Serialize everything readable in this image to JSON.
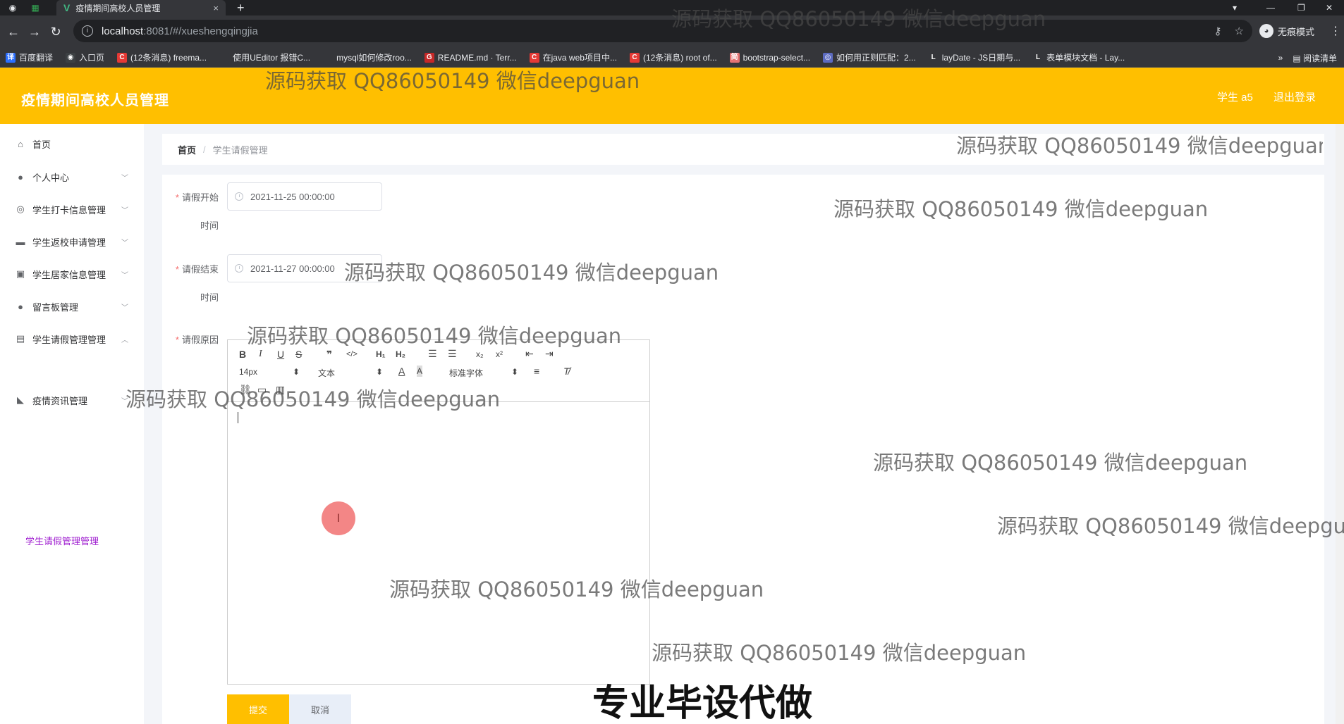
{
  "browser": {
    "tab_title": "疫情期间高校人员管理",
    "tab_close": "×",
    "new_tab": "+",
    "url_host": "localhost",
    "url_path": ":8081/#/xueshengqingjia",
    "incognito_label": "无痕模式",
    "bookmarks": [
      {
        "label": "百度翻译",
        "color": "#2b6fff",
        "glyph": "译"
      },
      {
        "label": "入口页",
        "color": "#3c4043",
        "glyph": "◉"
      },
      {
        "label": "(12条消息) freema...",
        "color": "#e53935",
        "glyph": "C"
      },
      {
        "label": "使用UEditor 报错C...",
        "color": "#35363a",
        "glyph": ""
      },
      {
        "label": "mysql如何修改roo...",
        "color": "#35363a",
        "glyph": ""
      },
      {
        "label": "README.md · Terr...",
        "color": "#c62828",
        "glyph": "G"
      },
      {
        "label": "在java web项目中...",
        "color": "#e53935",
        "glyph": "C"
      },
      {
        "label": "(12条消息) root of...",
        "color": "#e53935",
        "glyph": "C"
      },
      {
        "label": "bootstrap-select...",
        "color": "#e57373",
        "glyph": "简"
      },
      {
        "label": "如何用正则匹配：2...",
        "color": "#5c6bc0",
        "glyph": "◎"
      },
      {
        "label": "layDate - JS日期与...",
        "color": "#35363a",
        "glyph": "L"
      },
      {
        "label": "表单模块文档 - Lay...",
        "color": "#35363a",
        "glyph": "L"
      }
    ],
    "bookmarks_more": "»",
    "reading_list": "阅读清单"
  },
  "header": {
    "title": "疫情期间高校人员管理",
    "user": "学生 a5",
    "logout": "退出登录"
  },
  "sidebar": {
    "items": [
      {
        "label": "首页",
        "icon": "home-icon",
        "glyph": "⌂",
        "chevron": false
      },
      {
        "label": "个人中心",
        "icon": "user-icon",
        "glyph": "●",
        "chevron": true
      },
      {
        "label": "学生打卡信息管理",
        "icon": "target-icon",
        "glyph": "◎",
        "chevron": true
      },
      {
        "label": "学生返校申请管理",
        "icon": "briefcase-icon",
        "glyph": "▬",
        "chevron": true
      },
      {
        "label": "学生居家信息管理",
        "icon": "chart-icon",
        "glyph": "▣",
        "chevron": true
      },
      {
        "label": "留言板管理",
        "icon": "bulb-icon",
        "glyph": "●",
        "chevron": true
      },
      {
        "label": "学生请假管理管理",
        "icon": "clipboard-icon",
        "glyph": "▤",
        "chevron": true,
        "open": true
      },
      {
        "label": "疫情资讯管理",
        "icon": "megaphone-icon",
        "glyph": "◣",
        "chevron": true
      }
    ],
    "submenu_active": "学生请假管理管理"
  },
  "breadcrumb": {
    "home": "首页",
    "separator": "/",
    "current": "学生请假管理"
  },
  "form": {
    "start_label_1": "请假开始",
    "start_label_2": "时间",
    "start_value": "2021-11-25 00:00:00",
    "end_label_1": "请假结束",
    "end_label_2": "时间",
    "end_value": "2021-11-27 00:00:00",
    "reason_label": "请假原因",
    "required_mark": "*",
    "font_size": "14px",
    "text_type": "文本",
    "font_family": "标准字体",
    "submit": "提交",
    "cancel": "取消"
  },
  "watermarks": {
    "text": "源码获取 QQ86050149 微信deepguan",
    "big": "专业毕设代做"
  },
  "colors": {
    "brand": "#ffbf00",
    "active_submenu": "#a020d0"
  }
}
